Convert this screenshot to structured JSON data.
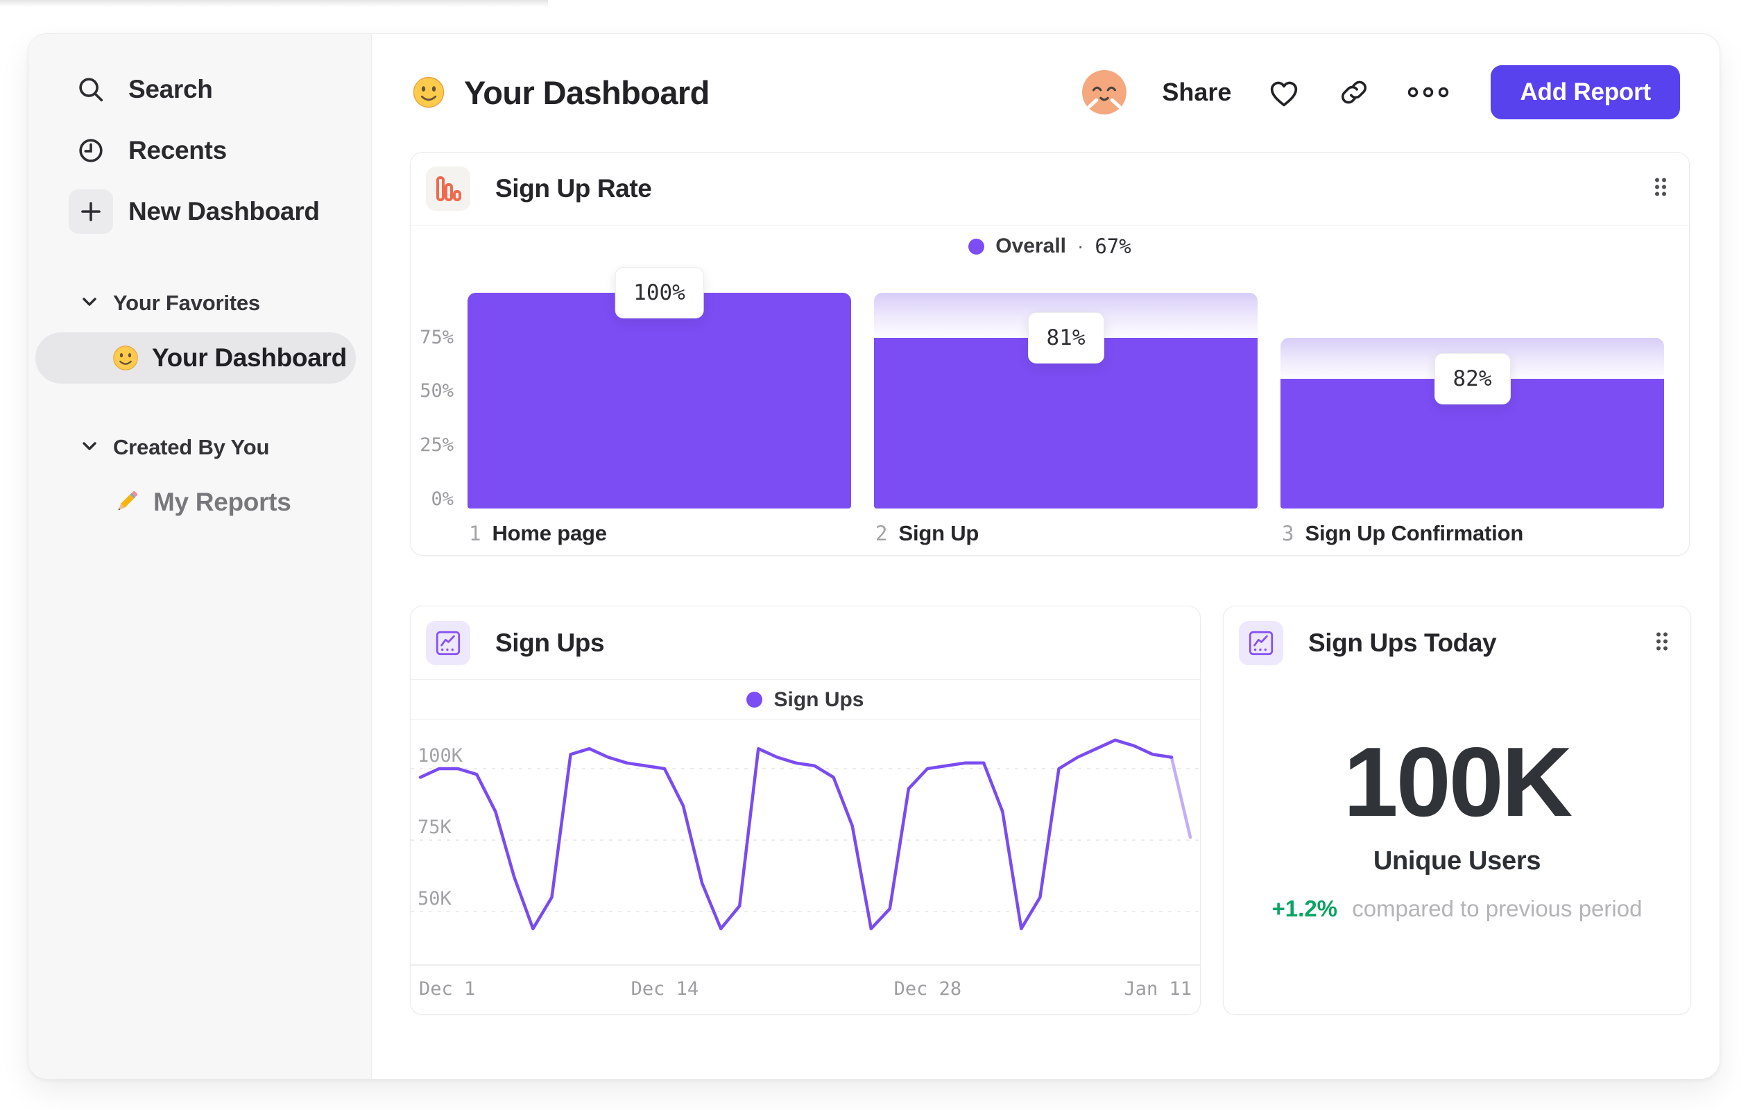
{
  "colors": {
    "accent": "#7c4df3",
    "button": "#5742ee",
    "green": "#0aa463",
    "orange_icon": "#ee6a4f"
  },
  "sidebar": {
    "nav": [
      {
        "label": "Search",
        "icon": "search-icon"
      },
      {
        "label": "Recents",
        "icon": "clock-icon"
      },
      {
        "label": "New Dashboard",
        "icon": "plus-icon"
      }
    ],
    "sections": [
      {
        "title": "Your Favorites",
        "items": [
          {
            "label": "Your Dashboard",
            "icon": "smiley-emoji",
            "selected": true
          }
        ]
      },
      {
        "title": "Created By You",
        "items": [
          {
            "label": "My Reports",
            "icon": "pencil-emoji",
            "selected": false
          }
        ]
      }
    ]
  },
  "header": {
    "title": "Your Dashboard",
    "icon": "smiley-emoji",
    "share_label": "Share",
    "add_report_label": "Add Report"
  },
  "cards": {
    "funnel": {
      "title": "Sign Up Rate",
      "legend": {
        "label": "Overall",
        "separator": "·",
        "value": "67%"
      },
      "y_ticks": [
        "75%",
        "50%",
        "25%",
        "0%"
      ],
      "steps": [
        {
          "num": "1",
          "name": "Home page",
          "label": "100%",
          "solid": 100,
          "ghost": 100
        },
        {
          "num": "2",
          "name": "Sign Up",
          "label": "81%",
          "solid": 79,
          "ghost": 100
        },
        {
          "num": "3",
          "name": "Sign Up Confirmation",
          "label": "82%",
          "solid": 60,
          "ghost": 79
        }
      ]
    },
    "line": {
      "title": "Sign Ups",
      "legend_label": "Sign Ups",
      "y_ticks": [
        "100K",
        "75K",
        "50K"
      ],
      "x_ticks": [
        "Dec 1",
        "Dec 14",
        "Dec 28",
        "Jan 11"
      ]
    },
    "today": {
      "title": "Sign Ups Today",
      "value": "100K",
      "unit": "Unique Users",
      "delta": "+1.2%",
      "delta_note": "compared to previous period"
    }
  },
  "chart_data": [
    {
      "type": "bar",
      "subtype": "funnel",
      "title": "Sign Up Rate",
      "series_name": "Overall",
      "overall_conversion": "67%",
      "categories": [
        "Home page",
        "Sign Up",
        "Sign Up Confirmation"
      ],
      "step_conversion_percent": [
        100,
        81,
        82
      ],
      "displayed_bar_height_percent": [
        100,
        79,
        60
      ],
      "ghost_height_percent": [
        100,
        100,
        79
      ],
      "ylim": [
        0,
        100
      ],
      "y_ticks_percent": [
        0,
        25,
        50,
        75
      ],
      "legend_position": "top-center",
      "grid": false
    },
    {
      "type": "line",
      "title": "Sign Ups",
      "x_ticks": [
        "Dec 1",
        "Dec 14",
        "Dec 28",
        "Jan 11"
      ],
      "y_ticks": [
        "50K",
        "75K",
        "100K"
      ],
      "unit": "K",
      "ylim": [
        40,
        115
      ],
      "grid": "dashed-horizontal",
      "legend_position": "top-center",
      "series": [
        {
          "name": "Sign Ups",
          "values": [
            97,
            100,
            100,
            98,
            85,
            62,
            44,
            55,
            105,
            107,
            104,
            102,
            101,
            100,
            87,
            60,
            44,
            52,
            107,
            104,
            102,
            101,
            97,
            80,
            44,
            51,
            93,
            100,
            101,
            102,
            102,
            85,
            44,
            55,
            100,
            104,
            107,
            110,
            108,
            105,
            104,
            76
          ]
        }
      ],
      "note": "final segment rendered faded"
    }
  ]
}
